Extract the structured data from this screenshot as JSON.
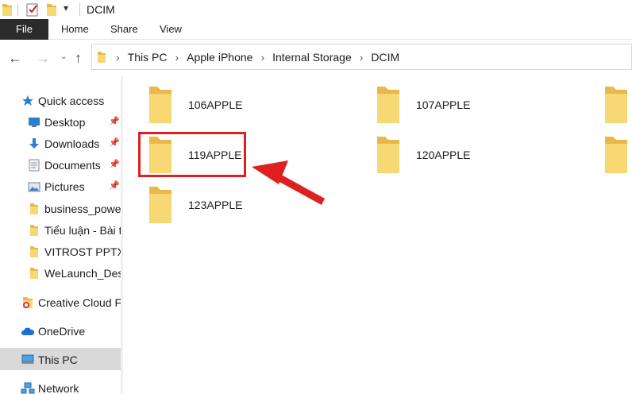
{
  "window": {
    "title": "DCIM"
  },
  "ribbon": {
    "tabs": [
      "File",
      "Home",
      "Share",
      "View"
    ]
  },
  "address": {
    "crumbs": [
      "This PC",
      "Apple iPhone",
      "Internal Storage",
      "DCIM"
    ]
  },
  "navpane": {
    "quick_access": "Quick access",
    "pinned": [
      {
        "label": "Desktop",
        "icon": "desktop-icon"
      },
      {
        "label": "Downloads",
        "icon": "downloads-icon"
      },
      {
        "label": "Documents",
        "icon": "documents-icon"
      },
      {
        "label": "Pictures",
        "icon": "pictures-icon"
      }
    ],
    "recent_folders": [
      "business_power",
      "Tiểu luận - Bài th",
      "VITROST PPTX",
      "WeLaunch_Desig"
    ],
    "creative_cloud": "Creative Cloud File",
    "onedrive": "OneDrive",
    "this_pc": "This PC",
    "network": "Network"
  },
  "folders": [
    "106APPLE",
    "107APPLE",
    "119APPLE",
    "120APPLE",
    "123APPLE"
  ],
  "colors": {
    "folder_yellow": "#f8d775",
    "highlight_red": "#e02020",
    "selected_bg": "#d9d9d9"
  }
}
